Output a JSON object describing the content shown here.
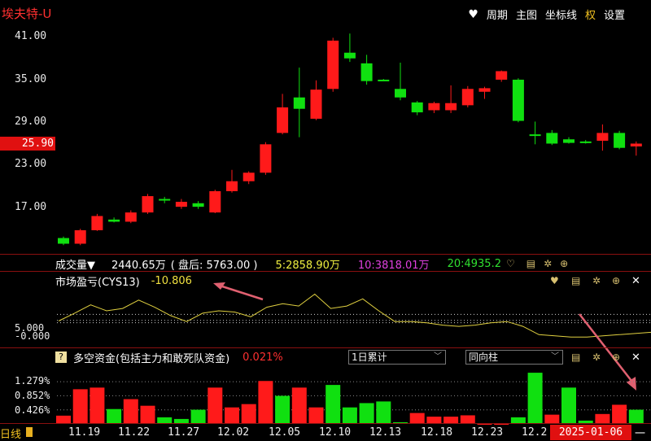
{
  "header": {
    "title": "埃夫特-U",
    "toolbar": {
      "weekly": "周期",
      "main_chart": "主图",
      "coord": "坐标线",
      "rights": "权",
      "settings": "设置"
    }
  },
  "price_axis": {
    "labels": [
      "41.00",
      "35.00",
      "29.00",
      "23.00",
      "17.00"
    ],
    "current": "25.90"
  },
  "volume_bar": {
    "label": "成交量▼",
    "total": "2440.65万",
    "after_hours": "( 盘后: 5763.00 )",
    "ma5": "5:2858.90万",
    "ma10": "10:3818.01万",
    "ma20": "20:4935.2"
  },
  "indicator": {
    "label": "市场盈亏(CYS13)",
    "value": "-10.806",
    "labels": [
      "5.000",
      "-0.000"
    ]
  },
  "funds": {
    "icon": "?",
    "label": "多空资金(包括主力和敢死队资金)",
    "value": "0.021%",
    "select1": "1日累计",
    "select2": "同向柱",
    "labels": [
      "1.279%",
      "0.852%",
      "0.426%"
    ]
  },
  "dates": [
    "11.19",
    "11.22",
    "11.27",
    "12.02",
    "12.05",
    "12.10",
    "12.13",
    "12.18",
    "12.23",
    "12.2"
  ],
  "period_tab": "日线",
  "current_date": "2025-01-06",
  "dash": "一",
  "colors": {
    "up": "#ff1a1a",
    "down": "#10e010",
    "flat": "#10e010",
    "line": "#e0d040",
    "arrow": "#e06070"
  },
  "chart_data": [
    {
      "type": "candlestick",
      "y_range": [
        11,
        44
      ],
      "candles": [
        {
          "o": 12.2,
          "h": 13.2,
          "l": 12.0,
          "c": 13.0,
          "d": "down"
        },
        {
          "o": 12.2,
          "h": 14.3,
          "l": 12.0,
          "c": 14.1,
          "d": "up"
        },
        {
          "o": 14.1,
          "h": 16.4,
          "l": 14.0,
          "c": 16.1,
          "d": "up"
        },
        {
          "o": 15.6,
          "h": 15.9,
          "l": 15.2,
          "c": 15.3,
          "d": "down"
        },
        {
          "o": 15.3,
          "h": 16.9,
          "l": 15.1,
          "c": 16.6,
          "d": "up"
        },
        {
          "o": 16.6,
          "h": 19.2,
          "l": 16.4,
          "c": 18.9,
          "d": "up"
        },
        {
          "o": 18.5,
          "h": 18.8,
          "l": 17.9,
          "c": 18.3,
          "d": "down"
        },
        {
          "o": 18.1,
          "h": 18.5,
          "l": 17.1,
          "c": 17.4,
          "d": "up"
        },
        {
          "o": 17.4,
          "h": 18.2,
          "l": 17.1,
          "c": 17.9,
          "d": "down"
        },
        {
          "o": 16.6,
          "h": 19.8,
          "l": 16.5,
          "c": 19.6,
          "d": "up"
        },
        {
          "o": 19.6,
          "h": 22.6,
          "l": 19.4,
          "c": 21.0,
          "d": "up"
        },
        {
          "o": 21.0,
          "h": 22.4,
          "l": 20.6,
          "c": 22.2,
          "d": "up"
        },
        {
          "o": 22.2,
          "h": 26.5,
          "l": 21.9,
          "c": 26.2,
          "d": "up"
        },
        {
          "o": 27.8,
          "h": 33.3,
          "l": 27.6,
          "c": 31.4,
          "d": "up"
        },
        {
          "o": 32.8,
          "h": 37.0,
          "l": 27.2,
          "c": 31.2,
          "d": "down"
        },
        {
          "o": 29.8,
          "h": 35.2,
          "l": 29.6,
          "c": 33.9,
          "d": "up"
        },
        {
          "o": 34.0,
          "h": 41.2,
          "l": 33.6,
          "c": 40.8,
          "d": "up"
        },
        {
          "o": 39.1,
          "h": 41.8,
          "l": 37.8,
          "c": 38.3,
          "d": "down"
        },
        {
          "o": 37.6,
          "h": 38.8,
          "l": 34.6,
          "c": 35.1,
          "d": "down"
        },
        {
          "o": 35.2,
          "h": 35.4,
          "l": 35.1,
          "c": 35.3,
          "d": "flat"
        },
        {
          "o": 34.0,
          "h": 37.7,
          "l": 32.4,
          "c": 32.8,
          "d": "down"
        },
        {
          "o": 32.1,
          "h": 32.3,
          "l": 30.3,
          "c": 30.7,
          "d": "down"
        },
        {
          "o": 31.0,
          "h": 32.2,
          "l": 30.6,
          "c": 32.0,
          "d": "up"
        },
        {
          "o": 31.0,
          "h": 34.5,
          "l": 30.6,
          "c": 32.0,
          "d": "up"
        },
        {
          "o": 31.7,
          "h": 34.4,
          "l": 31.4,
          "c": 34.0,
          "d": "up"
        },
        {
          "o": 33.6,
          "h": 34.3,
          "l": 32.6,
          "c": 34.1,
          "d": "up"
        },
        {
          "o": 35.3,
          "h": 36.6,
          "l": 35.0,
          "c": 36.5,
          "d": "up"
        },
        {
          "o": 35.3,
          "h": 35.5,
          "l": 29.3,
          "c": 29.5,
          "d": "down"
        },
        {
          "o": 27.6,
          "h": 29.4,
          "l": 26.2,
          "c": 27.6,
          "d": "flat"
        },
        {
          "o": 27.8,
          "h": 28.2,
          "l": 26.1,
          "c": 26.3,
          "d": "down"
        },
        {
          "o": 26.9,
          "h": 27.2,
          "l": 26.3,
          "c": 26.4,
          "d": "down"
        },
        {
          "o": 26.5,
          "h": 26.8,
          "l": 26.3,
          "c": 26.6,
          "d": "down"
        },
        {
          "o": 26.7,
          "h": 29.0,
          "l": 25.3,
          "c": 27.8,
          "d": "up"
        },
        {
          "o": 27.8,
          "h": 28.1,
          "l": 25.5,
          "c": 25.7,
          "d": "down"
        },
        {
          "o": 25.9,
          "h": 26.6,
          "l": 24.6,
          "c": 26.3,
          "d": "up"
        }
      ]
    },
    {
      "type": "line",
      "name": "CYS13",
      "y_range": [
        -22,
        38
      ],
      "values": [
        -0.5,
        6,
        13,
        8,
        10,
        17,
        11,
        4,
        -1,
        6,
        8,
        7,
        3,
        11,
        14,
        12,
        22,
        10,
        12,
        18,
        8,
        -1,
        -1,
        -2,
        -4,
        -5,
        -4,
        -2,
        -1,
        -5,
        -12,
        -13,
        -14,
        -14,
        -13,
        -12,
        -11,
        -10
      ]
    },
    {
      "type": "bar",
      "name": "多空资金",
      "y_range": [
        0,
        1.7
      ],
      "values": [
        0.25,
        1.05,
        1.1,
        0.45,
        0.75,
        0.55,
        0.2,
        0.15,
        0.43,
        1.1,
        0.5,
        0.6,
        1.3,
        0.85,
        1.1,
        0.5,
        1.18,
        0.5,
        0.63,
        0.68,
        0.05,
        0.33,
        0.22,
        0.22,
        0.26,
        0.0,
        0.0,
        0.2,
        1.55,
        0.28,
        1.1,
        0.1,
        0.3,
        0.58,
        0.43
      ],
      "directions": [
        "up",
        "up",
        "up",
        "down",
        "up",
        "up",
        "down",
        "down",
        "down",
        "up",
        "up",
        "up",
        "up",
        "down",
        "up",
        "up",
        "down",
        "down",
        "down",
        "down",
        "down",
        "up",
        "up",
        "up",
        "up",
        "up",
        "up",
        "down",
        "down",
        "up",
        "down",
        "down",
        "up",
        "up",
        "down"
      ]
    }
  ]
}
